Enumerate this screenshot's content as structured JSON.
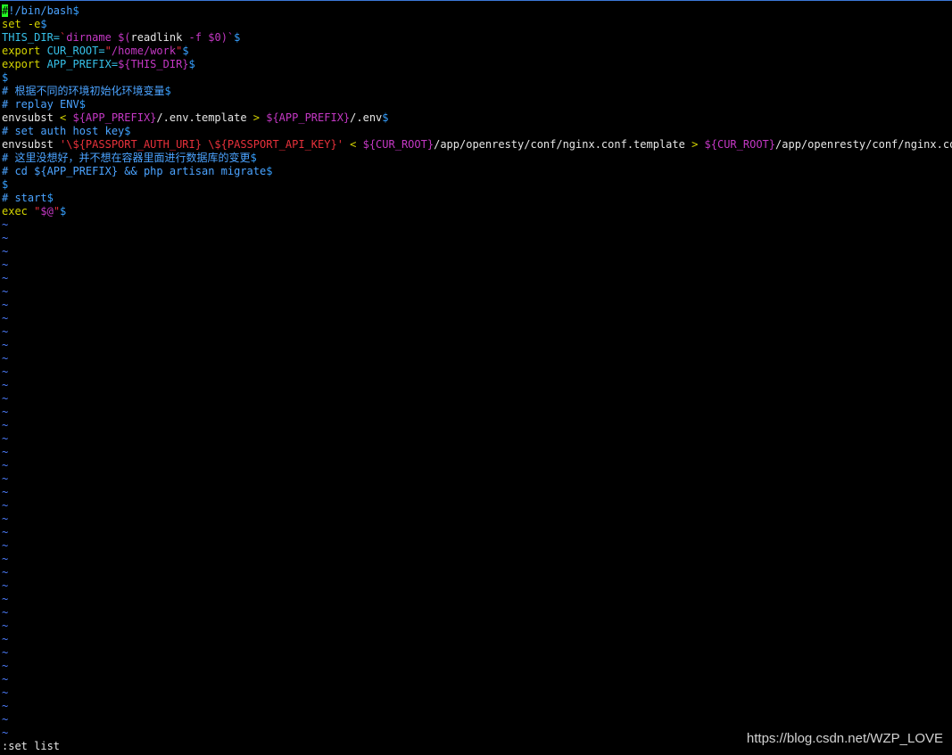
{
  "colors": {
    "default": "#e6e6e6",
    "comment": "#4ba3ff",
    "keyword": "#d4d400",
    "string": "#e8313b",
    "variable": "#c438c4",
    "identifier": "#36c0e8",
    "operator": "#d4d400",
    "eol": "#36a0ff",
    "tilde": "#4d7dfc",
    "cursor_bg": "#22ff22"
  },
  "lines": [
    [
      {
        "t": "#",
        "c": "cursor"
      },
      {
        "t": "!/bin/bash",
        "c": "comment"
      },
      {
        "t": "$",
        "c": "eol"
      }
    ],
    [
      {
        "t": "set -e",
        "c": "keyword"
      },
      {
        "t": "$",
        "c": "eol"
      }
    ],
    [
      {
        "t": "THIS_DIR=",
        "c": "identifier"
      },
      {
        "t": "`",
        "c": "string"
      },
      {
        "t": "dirname ",
        "c": "variable"
      },
      {
        "t": "$(",
        "c": "variable"
      },
      {
        "t": "readlink ",
        "c": "default"
      },
      {
        "t": "-f ",
        "c": "variable"
      },
      {
        "t": "$0",
        "c": "variable"
      },
      {
        "t": ")`",
        "c": "variable"
      },
      {
        "t": "$",
        "c": "eol"
      }
    ],
    [
      {
        "t": "export ",
        "c": "keyword"
      },
      {
        "t": "CUR_ROOT=",
        "c": "identifier"
      },
      {
        "t": "\"",
        "c": "string"
      },
      {
        "t": "/home/work",
        "c": "variable"
      },
      {
        "t": "\"",
        "c": "string"
      },
      {
        "t": "$",
        "c": "eol"
      }
    ],
    [
      {
        "t": "export ",
        "c": "keyword"
      },
      {
        "t": "APP_PREFIX=",
        "c": "identifier"
      },
      {
        "t": "${THIS_DIR}",
        "c": "variable"
      },
      {
        "t": "$",
        "c": "eol"
      }
    ],
    [
      {
        "t": "$",
        "c": "eol"
      }
    ],
    [
      {
        "t": "# 根据不同的环境初始化环境变量",
        "c": "comment"
      },
      {
        "t": "$",
        "c": "eol"
      }
    ],
    [
      {
        "t": "# replay ENV",
        "c": "comment"
      },
      {
        "t": "$",
        "c": "eol"
      }
    ],
    [
      {
        "t": "envsubst ",
        "c": "default"
      },
      {
        "t": "< ",
        "c": "operator"
      },
      {
        "t": "${APP_PREFIX}",
        "c": "variable"
      },
      {
        "t": "/.env.template ",
        "c": "default"
      },
      {
        "t": "> ",
        "c": "operator"
      },
      {
        "t": "${APP_PREFIX}",
        "c": "variable"
      },
      {
        "t": "/.env",
        "c": "default"
      },
      {
        "t": "$",
        "c": "eol"
      }
    ],
    [
      {
        "t": "# set auth host key",
        "c": "comment"
      },
      {
        "t": "$",
        "c": "eol"
      }
    ],
    [
      {
        "t": "envsubst ",
        "c": "default"
      },
      {
        "t": "'\\${PASSPORT_AUTH_URI} \\${PASSPORT_API_KEY}'",
        "c": "string"
      },
      {
        "t": " < ",
        "c": "operator"
      },
      {
        "t": "${CUR_ROOT}",
        "c": "variable"
      },
      {
        "t": "/app/openresty/conf/nginx.conf.template ",
        "c": "default"
      },
      {
        "t": "> ",
        "c": "operator"
      },
      {
        "t": "${CUR_ROOT}",
        "c": "variable"
      },
      {
        "t": "/app/openresty/conf/nginx.conf",
        "c": "default"
      },
      {
        "t": "$",
        "c": "eol"
      }
    ],
    [
      {
        "t": "# 这里没想好，并不想在容器里面进行数据库的变更",
        "c": "comment"
      },
      {
        "t": "$",
        "c": "eol"
      }
    ],
    [
      {
        "t": "# cd ${APP_PREFIX} && php artisan migrate",
        "c": "comment"
      },
      {
        "t": "$",
        "c": "eol"
      }
    ],
    [
      {
        "t": "$",
        "c": "eol"
      }
    ],
    [
      {
        "t": "# start",
        "c": "comment"
      },
      {
        "t": "$",
        "c": "eol"
      }
    ],
    [
      {
        "t": "exec ",
        "c": "keyword"
      },
      {
        "t": "\"",
        "c": "string"
      },
      {
        "t": "$@",
        "c": "variable"
      },
      {
        "t": "\"",
        "c": "string"
      },
      {
        "t": "$",
        "c": "eol"
      }
    ]
  ],
  "tilde_char": "~",
  "tilde_count": 39,
  "command_line": ":set list",
  "watermark": "https://blog.csdn.net/WZP_LOVE"
}
